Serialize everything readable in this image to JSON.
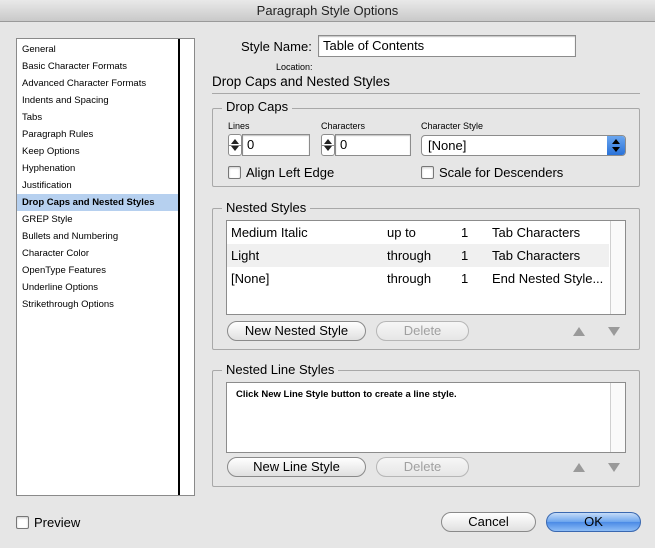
{
  "window": {
    "title": "Paragraph Style Options"
  },
  "categories": [
    {
      "label": "General"
    },
    {
      "label": "Basic Character Formats"
    },
    {
      "label": "Advanced Character Formats"
    },
    {
      "label": "Indents and Spacing"
    },
    {
      "label": "Tabs"
    },
    {
      "label": "Paragraph Rules"
    },
    {
      "label": "Keep Options"
    },
    {
      "label": "Hyphenation"
    },
    {
      "label": "Justification"
    },
    {
      "label": "Drop Caps and Nested Styles",
      "selected": true
    },
    {
      "label": "GREP Style"
    },
    {
      "label": "Bullets and Numbering"
    },
    {
      "label": "Character Color"
    },
    {
      "label": "OpenType Features"
    },
    {
      "label": "Underline Options"
    },
    {
      "label": "Strikethrough Options"
    }
  ],
  "style": {
    "name_label": "Style Name:",
    "name_value": "Table of Contents",
    "location_label": "Location:"
  },
  "section": {
    "heading": "Drop Caps and Nested Styles"
  },
  "drop_caps": {
    "title": "Drop Caps",
    "lines_label": "Lines",
    "lines_value": "0",
    "characters_label": "Characters",
    "characters_value": "0",
    "char_style_label": "Character Style",
    "char_style_value": "[None]",
    "align_left_edge_label": "Align Left Edge",
    "align_left_edge_checked": false,
    "scale_descenders_label": "Scale for Descenders",
    "scale_descenders_checked": false
  },
  "nested_styles": {
    "title": "Nested Styles",
    "rows": [
      {
        "style": "Medium Italic",
        "mode": "up to",
        "count": "1",
        "end": "Tab Characters"
      },
      {
        "style": "Light",
        "mode": "through",
        "count": "1",
        "end": "Tab Characters"
      },
      {
        "style": "[None]",
        "mode": "through",
        "count": "1",
        "end": "End Nested Style..."
      }
    ],
    "new_button": "New Nested Style",
    "delete_button": "Delete"
  },
  "nested_line_styles": {
    "title": "Nested Line Styles",
    "hint": "Click New Line Style button to create a line style.",
    "new_button": "New Line Style",
    "delete_button": "Delete"
  },
  "footer": {
    "preview_label": "Preview",
    "preview_checked": false,
    "cancel_label": "Cancel",
    "ok_label": "OK"
  },
  "colors": {
    "selection": "#b6d0ef",
    "default_button": "#4b8ae6"
  }
}
